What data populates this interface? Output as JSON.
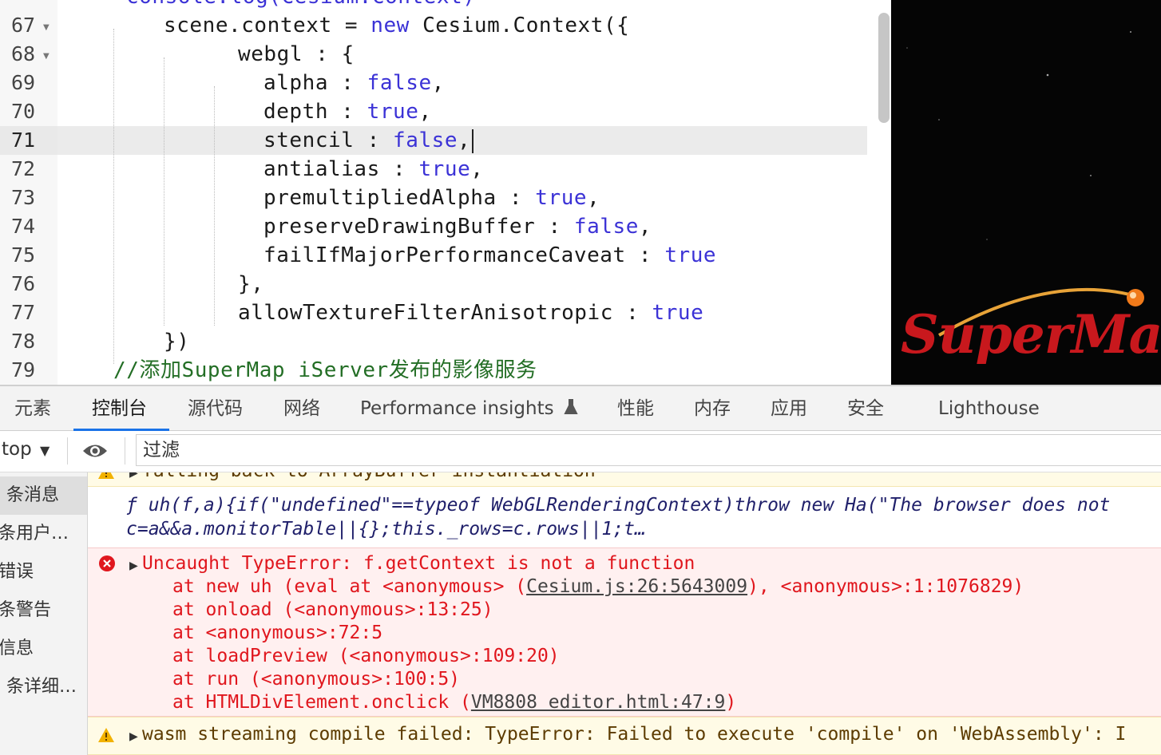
{
  "editor": {
    "lines": [
      {
        "num": "67",
        "fold": true,
        "indent": 205,
        "parts": [
          {
            "t": "scene.context = "
          },
          {
            "t": "new",
            "c": "kw"
          },
          {
            "t": " Cesium.Context({"
          }
        ]
      },
      {
        "num": "68",
        "fold": true,
        "indent": 298,
        "parts": [
          {
            "t": "webgl : {"
          }
        ]
      },
      {
        "num": "69",
        "fold": false,
        "indent": 330,
        "parts": [
          {
            "t": "alpha : "
          },
          {
            "t": "false",
            "c": "kw"
          },
          {
            "t": ","
          }
        ]
      },
      {
        "num": "70",
        "fold": false,
        "indent": 330,
        "parts": [
          {
            "t": "depth : "
          },
          {
            "t": "true",
            "c": "kw"
          },
          {
            "t": ","
          }
        ]
      },
      {
        "num": "71",
        "fold": false,
        "indent": 330,
        "active": true,
        "parts": [
          {
            "t": "stencil : "
          },
          {
            "t": "false",
            "c": "kw"
          },
          {
            "t": ","
          }
        ]
      },
      {
        "num": "72",
        "fold": false,
        "indent": 330,
        "parts": [
          {
            "t": "antialias : "
          },
          {
            "t": "true",
            "c": "kw"
          },
          {
            "t": ","
          }
        ]
      },
      {
        "num": "73",
        "fold": false,
        "indent": 330,
        "parts": [
          {
            "t": "premultipliedAlpha : "
          },
          {
            "t": "true",
            "c": "kw"
          },
          {
            "t": ","
          }
        ]
      },
      {
        "num": "74",
        "fold": false,
        "indent": 330,
        "parts": [
          {
            "t": "preserveDrawingBuffer : "
          },
          {
            "t": "false",
            "c": "kw"
          },
          {
            "t": ","
          }
        ]
      },
      {
        "num": "75",
        "fold": false,
        "indent": 330,
        "parts": [
          {
            "t": "failIfMajorPerformanceCaveat : "
          },
          {
            "t": "true",
            "c": "kw"
          }
        ]
      },
      {
        "num": "76",
        "fold": false,
        "indent": 298,
        "parts": [
          {
            "t": "},"
          }
        ]
      },
      {
        "num": "77",
        "fold": false,
        "indent": 298,
        "parts": [
          {
            "t": "allowTextureFilterAnisotropic : "
          },
          {
            "t": "true",
            "c": "kw"
          }
        ]
      },
      {
        "num": "78",
        "fold": false,
        "indent": 205,
        "parts": [
          {
            "t": "})"
          }
        ]
      },
      {
        "num": "79",
        "fold": false,
        "indent": 142,
        "parts": [
          {
            "t": "//添加SuperMap iServer发布的影像服务",
            "c": "cm"
          }
        ]
      }
    ]
  },
  "preview": {
    "logo_text": "SuperMap",
    "logo_color": "#c8181d",
    "orb_color": "#f07a1a"
  },
  "devtools": {
    "tabs": [
      "元素",
      "控制台",
      "源代码",
      "网络",
      "Performance insights",
      "性能",
      "内存",
      "应用",
      "安全",
      "Lighthouse"
    ],
    "selected_tab": "控制台",
    "accent": "#1a73e8"
  },
  "toolbar": {
    "context": "top",
    "filter_placeholder": "过滤"
  },
  "sidebar": {
    "items": [
      "条消息",
      "条用户…",
      "错误",
      "条警告",
      "信息",
      "条详细…"
    ],
    "selected_index": 0
  },
  "console": {
    "warning_top": "falling back to ArrayBuffer instantiation",
    "log_line1": "ƒ uh(f,a){if(\"undefined\"==typeof WebGLRenderingContext)throw new Ha(\"The browser does not",
    "log_line2": "c=a&&a.monitorTable||{};this._rows=c.rows||1;t…",
    "error_title": "Uncaught TypeError: f.getContext is not a function",
    "stack": {
      "l1_pre": "at new uh (eval at <anonymous> (",
      "l1_link": "Cesium.js:26:5643009",
      "l1_post": "), <anonymous>:1:1076829)",
      "l2": "at onload (<anonymous>:13:25)",
      "l3": "at <anonymous>:72:5",
      "l4": "at loadPreview (<anonymous>:109:20)",
      "l5": "at run (<anonymous>:100:5)",
      "l6_pre": "at HTMLDivElement.onclick (",
      "l6_link": "VM8808 editor.html:47:9",
      "l6_post": ")"
    },
    "warning_bottom": "wasm streaming compile failed: TypeError: Failed to execute 'compile' on 'WebAssembly': I"
  }
}
